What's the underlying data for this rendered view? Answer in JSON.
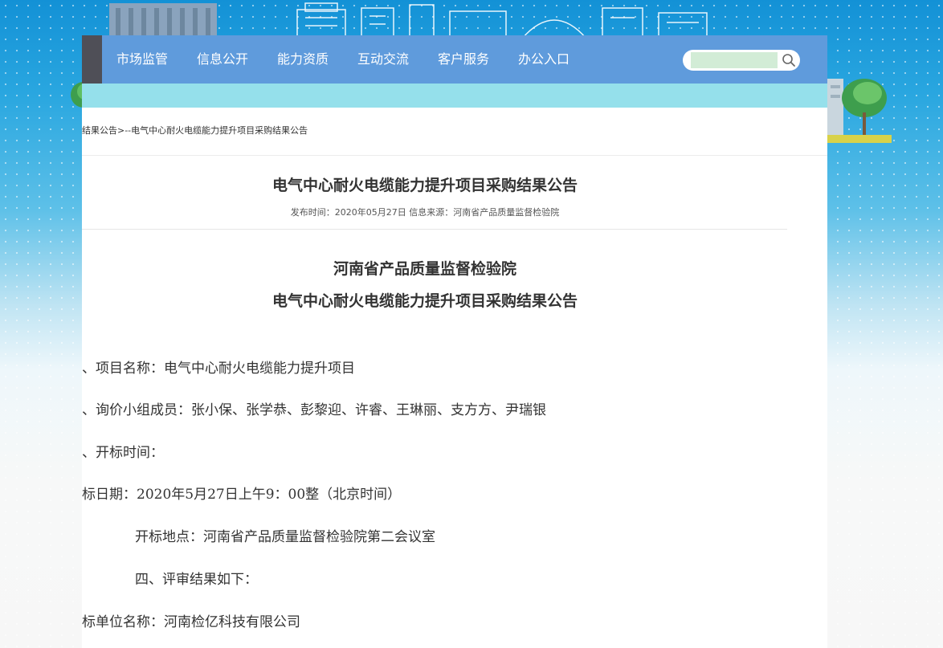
{
  "nav": {
    "items": [
      "市场监管",
      "信息公开",
      "能力资质",
      "互动交流",
      "客户服务",
      "办公入口"
    ]
  },
  "search": {
    "placeholder": ""
  },
  "breadcrumb": "结果公告>--电气中心耐火电缆能力提升项目采购结果公告",
  "article": {
    "title": "电气中心耐火电缆能力提升项目采购结果公告",
    "meta": "发布时间：2020年05月27日 信息来源：河南省产品质量监督检验院"
  },
  "body": {
    "title_line1": "河南省产品质量监督检验院",
    "title_line2": "电气中心耐火电缆能力提升项目采购结果公告",
    "paragraphs": [
      "、项目名称：电气中心耐火电缆能力提升项目",
      "、询价小组成员：张小保、张学恭、彭黎迎、许睿、王琳丽、支方方、尹瑞银",
      "、开标时间：",
      "标日期：2020年5月27日上午9：00整（北京时间）",
      "开标地点：河南省产品质量监督检验院第二会议室",
      "四、评审结果如下：",
      "标单位名称：河南检亿科技有限公司"
    ]
  },
  "colors": {
    "nav_bg": "#5f9bdc",
    "nav_dark": "#4f4f57",
    "subbar": "#95e0eb",
    "sky": "#1391d6"
  }
}
